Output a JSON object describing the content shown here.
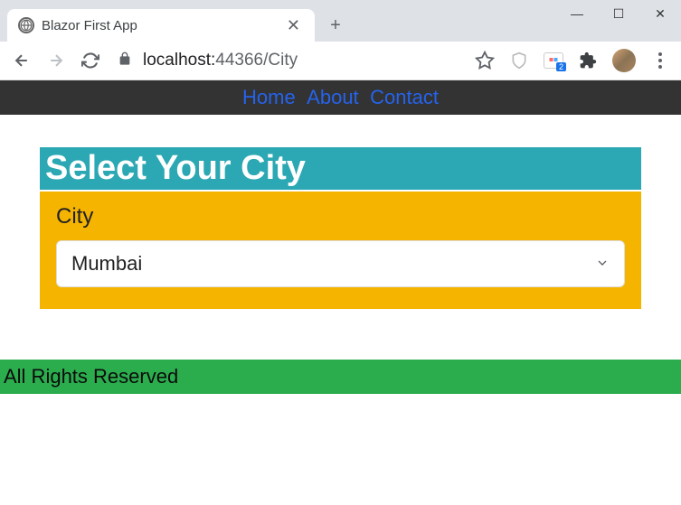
{
  "window": {
    "minimize": "—",
    "maximize": "☐",
    "close": "✕"
  },
  "browser": {
    "tab_title": "Blazor First App",
    "tab_close": "✕",
    "new_tab": "+",
    "address_host": "localhost:",
    "address_port_path": "44366/City"
  },
  "extension_badge": "2",
  "nav": {
    "home": "Home",
    "about": "About",
    "contact": "Contact"
  },
  "page": {
    "title": "Select Your City",
    "field_label": "City",
    "selected_value": "Mumbai"
  },
  "footer": {
    "text": "All Rights Reserved"
  }
}
